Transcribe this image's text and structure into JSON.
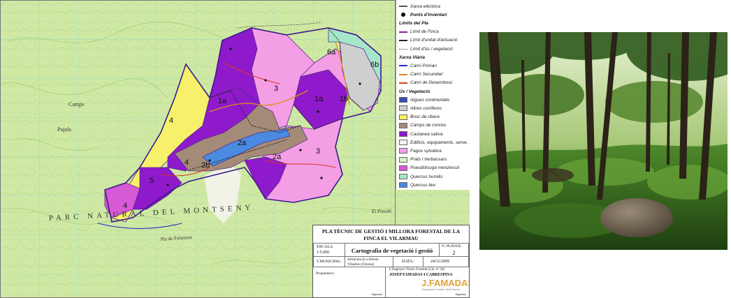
{
  "map": {
    "park_label": "PARC NATURAL DEL MONTSENY",
    "place_labels": [
      "Camps",
      "Pujols",
      "El Porcell",
      "Pla de Palamera"
    ],
    "zone_labels": [
      "1a",
      "1a",
      "1b",
      "2a",
      "2a",
      "2b",
      "3",
      "3",
      "4",
      "4",
      "4",
      "5",
      "6a",
      "6b"
    ]
  },
  "legend": {
    "items": [
      {
        "label": "Xarxa elèctrica",
        "kind": "line",
        "color": "#555555",
        "head": false
      },
      {
        "label": "Punts d'inventari",
        "kind": "dot",
        "color": "#000000",
        "head": true
      },
      {
        "label": "Límits del Pla",
        "kind": "none",
        "color": "",
        "head": true
      },
      {
        "label": "Límit de Finca",
        "kind": "line",
        "color": "#8a1a9a",
        "head": false
      },
      {
        "label": "Límit d'unitat d'actuació",
        "kind": "dash",
        "color": "#222222",
        "head": false
      },
      {
        "label": "Límit d'ús / vegetació",
        "kind": "dot-line",
        "color": "#444444",
        "head": false
      },
      {
        "label": "Xarxa Viària",
        "kind": "none",
        "color": "",
        "head": true
      },
      {
        "label": "Camí Primari",
        "kind": "line",
        "color": "#2222cc",
        "head": false
      },
      {
        "label": "Camí Secundari",
        "kind": "line",
        "color": "#e08a1a",
        "head": false
      },
      {
        "label": "Camí de Desembosc",
        "kind": "line",
        "color": "#d93a1a",
        "head": false
      },
      {
        "label": "Ús / Vegetació",
        "kind": "none",
        "color": "",
        "head": true
      },
      {
        "label": "Aigues continentals",
        "kind": "box",
        "color": "#3a4ab0",
        "head": false
      },
      {
        "label": "Altres coníferes",
        "kind": "box",
        "color": "#cfcfcf",
        "head": false
      },
      {
        "label": "Bosc de ribera",
        "kind": "box",
        "color": "#f7f06a",
        "head": false
      },
      {
        "label": "Camps de conreu",
        "kind": "box",
        "color": "#a48b78",
        "head": false
      },
      {
        "label": "Castanea sativa",
        "kind": "box",
        "color": "#8e1acb",
        "head": false
      },
      {
        "label": "Edificis, equipaments, serve.",
        "kind": "box",
        "color": "#f2f2f2",
        "head": false
      },
      {
        "label": "Fagus sylvatica",
        "kind": "box",
        "color": "#f49ee6",
        "head": false
      },
      {
        "label": "Prats i herbassars",
        "kind": "box",
        "color": "#d8efc6",
        "head": false
      },
      {
        "label": "Pseudotsuga menziessii",
        "kind": "box",
        "color": "#d65ad6",
        "head": false
      },
      {
        "label": "Quercus humilis",
        "kind": "box",
        "color": "#a6e6c8",
        "head": false
      },
      {
        "label": "Quercus ilex",
        "kind": "box",
        "color": "#4a8ae0",
        "head": false
      }
    ]
  },
  "titleblock": {
    "title_line1": "PLA TÈCNIC DE GESTIÓ I MILLORA FORESTAL DE LA",
    "title_line2": "FINCA EL VILARMAU",
    "escala_label": "ESCALA",
    "escala_value": "1:5.000",
    "map_title": "Cartografia de vegetació i gestió",
    "plan_label": "N. PLÀNOL",
    "plan_number": "2",
    "municipal_label": "T.MUNICIPAL:",
    "municipal_line1": "Arbúcies (La Selva)",
    "municipal_line2": "Viladrau (Osona)",
    "date_label": "DATA:",
    "date_value": "24/11/2009",
    "owner_label": "Propietari/s:",
    "engineer_role": "L'Enginyer Tècnic Forestal (Col. nº 34)",
    "engineer_name": "JOSEP FAMADAS I CABRESPINA",
    "logo_text": "J.FAMADAS",
    "logo_subtitle": "Enginyeria, Forestal i Medi Natural",
    "signature_label_left": "Signatura",
    "signature_label_right": "Signatura"
  },
  "colors": {
    "topo_bg": "#cfe9a4",
    "grid": "#7fd1c8",
    "castanea": "#8e1acb",
    "fagus": "#f49ee6",
    "ribera": "#f7f06a",
    "conreu": "#a48b78",
    "ilex": "#4a8ae0",
    "humilis": "#a6e6c8",
    "prats": "#d8efc6",
    "altres": "#cfcfcf",
    "boundary": "#3a1a8a"
  }
}
